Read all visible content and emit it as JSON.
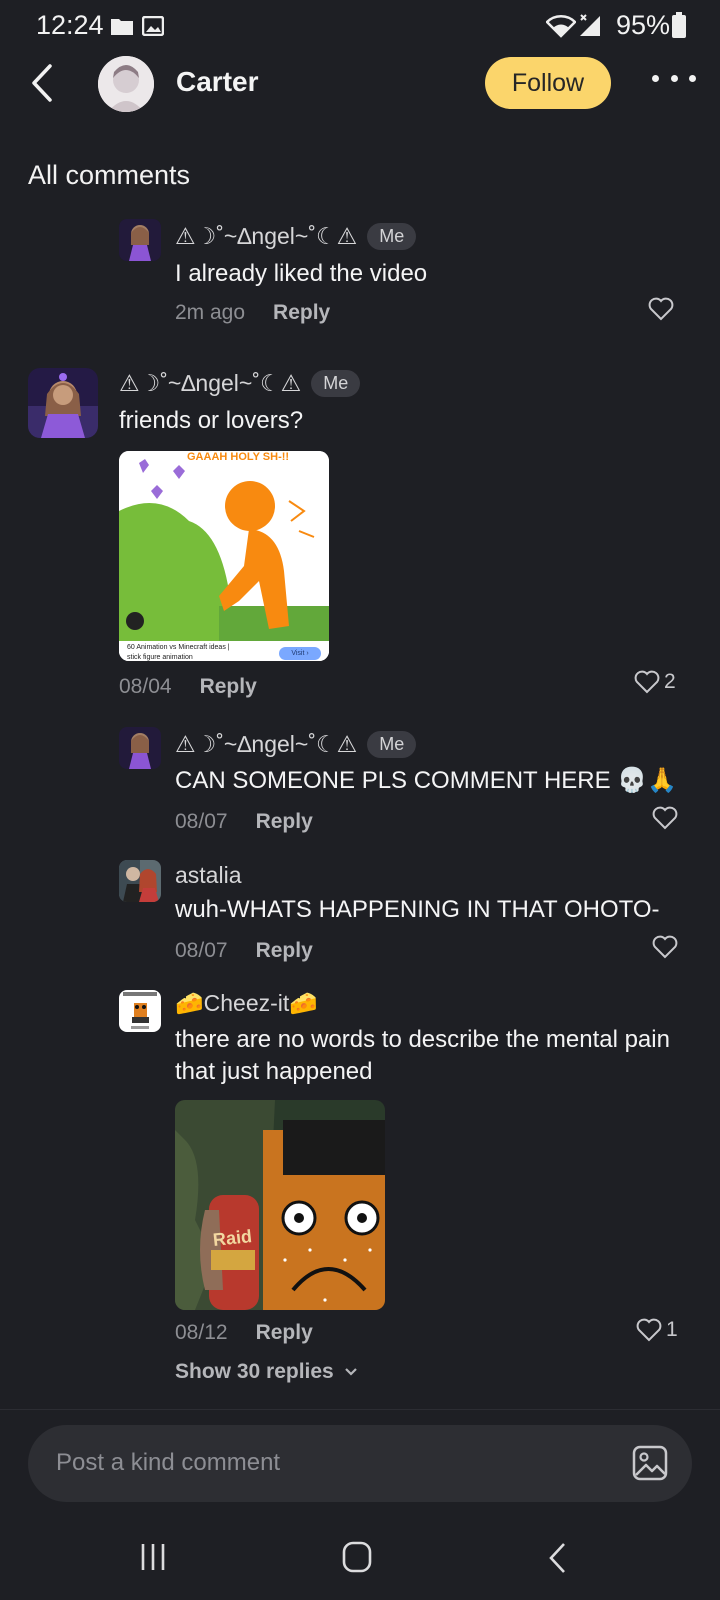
{
  "status_bar": {
    "time": "12:24",
    "battery": "95%"
  },
  "header": {
    "name": "Carter",
    "follow_label": "Follow"
  },
  "section_title": "All comments",
  "comments": [
    {
      "user": "⚠︎☽˚~∆ngel~˚☾⚠︎",
      "badge": "Me",
      "text": "I already liked the video",
      "time": "2m ago",
      "reply": "Reply",
      "likes": ""
    },
    {
      "user": "⚠︎☽˚~∆ngel~˚☾⚠︎",
      "badge": "Me",
      "text": "friends or lovers?",
      "time": "08/04",
      "reply": "Reply",
      "likes": "2",
      "attachment": {
        "caption_top": "GAAAH HOLY SH-!!",
        "footer_text": "60 Animation vs Minecraft ideas |",
        "footer_sub": "stick figure animation",
        "visit_label": "Visit ›"
      }
    },
    {
      "user": "⚠︎☽˚~∆ngel~˚☾⚠︎",
      "badge": "Me",
      "text": "CAN SOMEONE PLS COMMENT HERE 💀🙏",
      "time": "08/07",
      "reply": "Reply",
      "likes": ""
    },
    {
      "user": "astalia",
      "text": "wuh-WHATS HAPPENING IN THAT OHOTO-",
      "time": "08/07",
      "reply": "Reply",
      "likes": ""
    },
    {
      "user": "🧀Cheez-it🧀",
      "text_line1": "there are no words to describe the mental pain",
      "text_line2": "that just happened",
      "time": "08/12",
      "reply": "Reply",
      "likes": "1",
      "attachment": {
        "can_label": "Raid"
      },
      "show_replies": "Show 30 replies"
    }
  ],
  "composer": {
    "placeholder": "Post a kind comment"
  },
  "icons": {
    "back": "chevron-left-icon",
    "more": "more-dots-icon",
    "heart": "heart-outline-icon",
    "image": "image-icon",
    "wifi": "wifi-icon",
    "signal": "signal-icon",
    "battery": "battery-icon"
  },
  "colors": {
    "background": "#1e1f24",
    "follow_button": "#fbd56b",
    "badge": "#3a3b42"
  }
}
